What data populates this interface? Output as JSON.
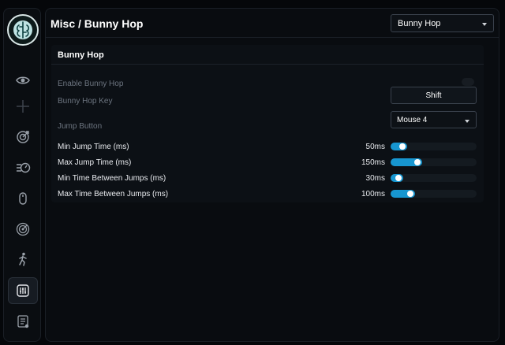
{
  "header": {
    "title": "Misc / Bunny Hop",
    "feature_select": "Bunny Hop"
  },
  "sidebar": {
    "items": [
      {
        "icon": "eye-icon"
      },
      {
        "icon": "crosshair-icon"
      },
      {
        "icon": "target-aim-icon"
      },
      {
        "icon": "speedometer-icon"
      },
      {
        "icon": "mouse-icon"
      },
      {
        "icon": "radar-icon"
      },
      {
        "icon": "running-figure-icon"
      },
      {
        "icon": "sliders-icon",
        "active": true
      },
      {
        "icon": "config-list-icon"
      }
    ]
  },
  "bunny_hop": {
    "section_title": "Bunny Hop",
    "enable_label": "Enable Bunny Hop",
    "enable_checked": false,
    "key_label": "Bunny Hop Key",
    "key_value": "Shift",
    "jump_button_label": "Jump Button",
    "jump_button_value": "Mouse 4",
    "sliders": [
      {
        "label": "Min Jump Time (ms)",
        "value": "50ms",
        "fraction": 0.19
      },
      {
        "label": "Max Jump Time (ms)",
        "value": "150ms",
        "fraction": 0.37
      },
      {
        "label": "Min Time Between Jumps (ms)",
        "value": "30ms",
        "fraction": 0.15
      },
      {
        "label": "Max Time Between Jumps (ms)",
        "value": "100ms",
        "fraction": 0.28
      }
    ]
  },
  "colors": {
    "accent": "#1796d0",
    "background": "#05070a",
    "panel": "#0c1015"
  }
}
